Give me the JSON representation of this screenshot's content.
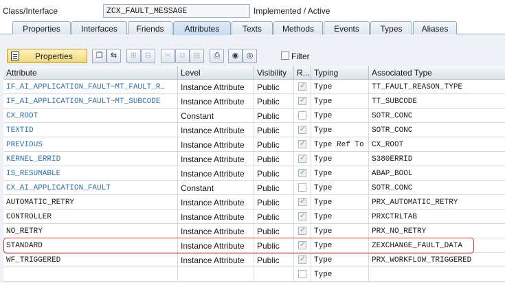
{
  "header": {
    "class_label": "Class/Interface",
    "class_value": "ZCX_FAULT_MESSAGE",
    "status": "Implemented / Active"
  },
  "tabs": [
    {
      "label": "Properties"
    },
    {
      "label": "Interfaces"
    },
    {
      "label": "Friends"
    },
    {
      "label": "Attributes",
      "active": true
    },
    {
      "label": "Texts"
    },
    {
      "label": "Methods"
    },
    {
      "label": "Events"
    },
    {
      "label": "Types"
    },
    {
      "label": "Aliases"
    }
  ],
  "toolbar": {
    "properties_label": "Properties",
    "filter_label": "Filter"
  },
  "table": {
    "columns": [
      "Attribute",
      "Level",
      "Visibility",
      "R...",
      "Typing",
      "Associated Type"
    ],
    "rows": [
      {
        "attribute": "IF_AI_APPLICATION_FAULT~MT_FAULT_R…",
        "level": "Instance Attribute",
        "visibility": "Public",
        "readonly": true,
        "typing": "Type",
        "assoc": "TT_FAULT_REASON_TYPE",
        "inherited": true
      },
      {
        "attribute": "IF_AI_APPLICATION_FAULT~MT_SUBCODE",
        "level": "Instance Attribute",
        "visibility": "Public",
        "readonly": true,
        "typing": "Type",
        "assoc": "TT_SUBCODE",
        "inherited": true
      },
      {
        "attribute": "CX_ROOT",
        "level": "Constant",
        "visibility": "Public",
        "readonly": false,
        "typing": "Type",
        "assoc": "SOTR_CONC",
        "inherited": true
      },
      {
        "attribute": "TEXTID",
        "level": "Instance Attribute",
        "visibility": "Public",
        "readonly": true,
        "typing": "Type",
        "assoc": "SOTR_CONC",
        "inherited": true
      },
      {
        "attribute": "PREVIOUS",
        "level": "Instance Attribute",
        "visibility": "Public",
        "readonly": true,
        "typing": "Type Ref To",
        "assoc": "CX_ROOT",
        "inherited": true
      },
      {
        "attribute": "KERNEL_ERRID",
        "level": "Instance Attribute",
        "visibility": "Public",
        "readonly": true,
        "typing": "Type",
        "assoc": "S380ERRID",
        "inherited": true
      },
      {
        "attribute": "IS_RESUMABLE",
        "level": "Instance Attribute",
        "visibility": "Public",
        "readonly": true,
        "typing": "Type",
        "assoc": "ABAP_BOOL",
        "inherited": true
      },
      {
        "attribute": "CX_AI_APPLICATION_FAULT",
        "level": "Constant",
        "visibility": "Public",
        "readonly": false,
        "typing": "Type",
        "assoc": "SOTR_CONC",
        "inherited": true
      },
      {
        "attribute": "AUTOMATIC_RETRY",
        "level": "Instance Attribute",
        "visibility": "Public",
        "readonly": true,
        "typing": "Type",
        "assoc": "PRX_AUTOMATIC_RETRY",
        "inherited": false
      },
      {
        "attribute": "CONTROLLER",
        "level": "Instance Attribute",
        "visibility": "Public",
        "readonly": true,
        "typing": "Type",
        "assoc": "PRXCTRLTAB",
        "inherited": false
      },
      {
        "attribute": "NO_RETRY",
        "level": "Instance Attribute",
        "visibility": "Public",
        "readonly": true,
        "typing": "Type",
        "assoc": "PRX_NO_RETRY",
        "inherited": false
      },
      {
        "attribute": "STANDARD",
        "level": "Instance Attribute",
        "visibility": "Public",
        "readonly": true,
        "typing": "Type",
        "assoc": "ZEXCHANGE_FAULT_DATA",
        "inherited": false
      },
      {
        "attribute": "WF_TRIGGERED",
        "level": "Instance Attribute",
        "visibility": "Public",
        "readonly": true,
        "typing": "Type",
        "assoc": "PRX_WORKFLOW_TRIGGERED",
        "inherited": false
      },
      {
        "attribute": "",
        "level": "",
        "visibility": "",
        "readonly": false,
        "typing": "Type",
        "assoc": "",
        "inherited": false
      }
    ]
  },
  "colors": {
    "inherited_text": "#2f6fa8",
    "highlight": "#d32f2f",
    "active_tab": "#c7dcf1"
  }
}
